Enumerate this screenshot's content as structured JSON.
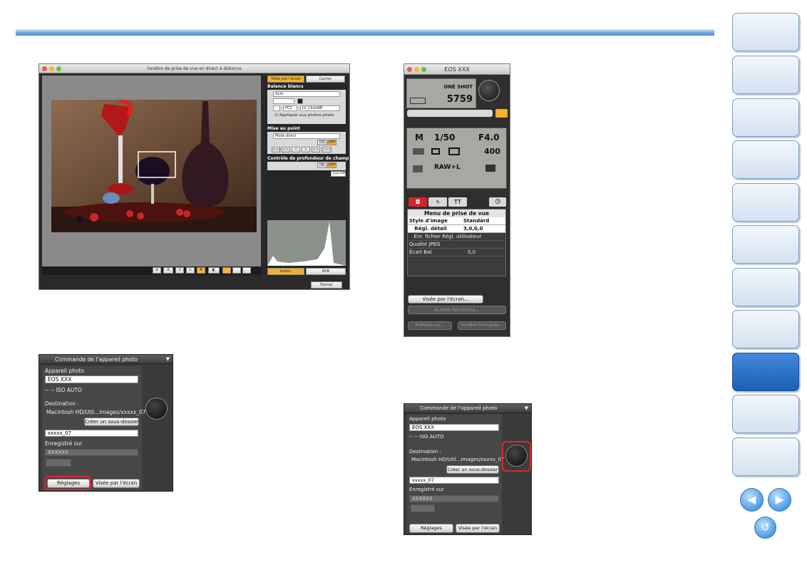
{
  "nav": {
    "tabs": [
      "",
      "",
      "",
      "",
      "",
      "",
      "",
      "",
      "",
      "",
      ""
    ],
    "active": 8,
    "prev": "◀",
    "next": "▶",
    "home": "↺"
  },
  "liveview": {
    "title": "Fenêtre de prise de vue en direct à distance",
    "tab_screen": "Visée par l'écran",
    "tab_hide": "Cacher",
    "wb_label": "Balance blancs",
    "wb_value": "Auto",
    "pc1": "PC1",
    "lv_clickwb": "LV_ClickWB",
    "apply": "Appliquer aux photos prises",
    "focus_label": "Mise au point",
    "focus_value": "Mode direct",
    "on": "ON",
    "off": "OFF",
    "focus_steps": [
      "<<<",
      "<<",
      "<",
      ">",
      ">>",
      ">>>"
    ],
    "dof_label": "Contrôle de profondeur de champ",
    "expsim": "Exp.SIM",
    "lumin": "Lumin.",
    "rvb": "RVB",
    "fermer": "Fermer"
  },
  "eos": {
    "title": "EOS XXX",
    "af_mode": "ONE SHOT",
    "shots": "5759",
    "mode": "M",
    "shutter": "1/50",
    "aperture": "F4.0",
    "iso": "400",
    "quality": "RAW+L",
    "menu_title": "Menu de prise de vue",
    "menu_rows": [
      {
        "label": "Style d'image",
        "value": "Standard",
        "bold": true
      },
      {
        "label": "   Régl. détail",
        "value": "3,0,0,0",
        "bold": true
      },
      {
        "label": "   Enr. fichier Régl. utilisateur",
        "value": "",
        "bold": false
      },
      {
        "label": "Qualité JPEG",
        "value": "",
        "bold": false
      },
      {
        "label": "Écart Bal",
        "value": "0,0",
        "bold": false
      }
    ],
    "btn_live": "Visée par l'écran...",
    "btn_other": "Autres fonctions...",
    "btn_prefs": "Préférences...",
    "btn_main": "Fenêtre Principale..."
  },
  "panel1": {
    "title": "Commande de l'appareil photo",
    "camera_label": "Appareil photo",
    "camera_value": "EOS XXX",
    "iso_line": "-- --  ISO AUTO",
    "dest_label": "Destination :",
    "dest_path": "Macintosh HD/Util...Images/xxxxx_07",
    "create_btn": "Créer un sous-dossier",
    "folder": "xxxxx_07",
    "save_label": "Enregistré sur",
    "save_value": "XXXXXX",
    "settings_btn": "Réglages",
    "live_btn": "Visée par l'écran"
  },
  "panel2": {
    "title": "Commande de l'appareil photo",
    "camera_label": "Appareil photo",
    "camera_value": "EOS XXX",
    "iso_line": "-- --  ISO AUTO",
    "dest_label": "Destination :",
    "dest_path": "Macintosh HD/Util...Images/xxxxx_07",
    "create_btn": "Créer un sous-dossier",
    "folder": "xxxxx_07",
    "save_label": "Enregistré sur",
    "save_value": "XXXXXX",
    "settings_btn": "Réglages",
    "live_btn": "Visée par l'écran"
  },
  "colors": {
    "accent": "#1b5fb5",
    "highlight": "#e0262c",
    "orange": "#f7b733"
  }
}
